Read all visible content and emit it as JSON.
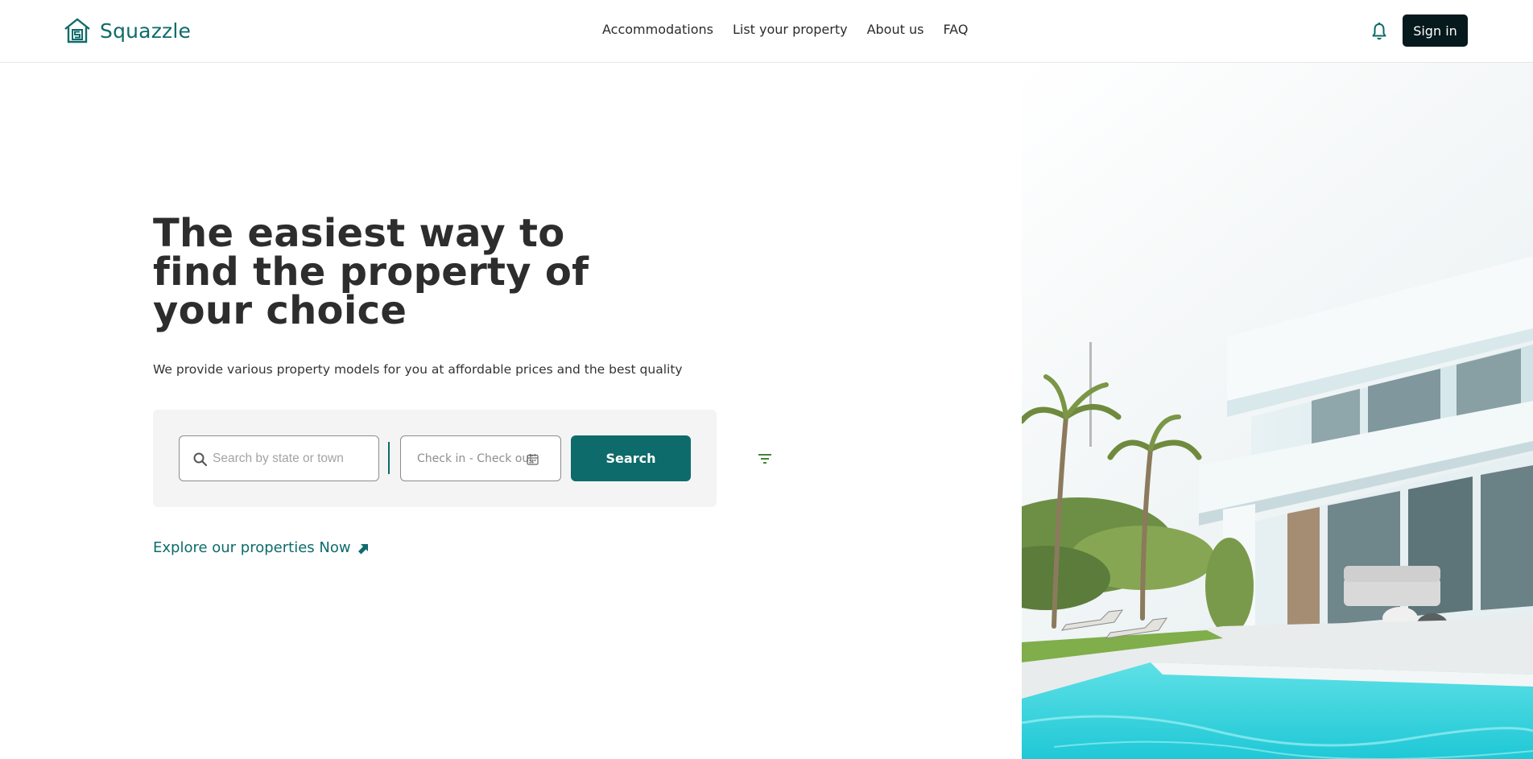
{
  "brand": {
    "name": "Squazzle",
    "color": "#0e6b6b"
  },
  "nav": {
    "links": [
      "Accommodations",
      "List your property",
      "About us",
      "FAQ"
    ]
  },
  "header": {
    "notification_icon": "bell-icon",
    "signin_label": "Sign in"
  },
  "hero": {
    "headline": "The easiest way to find the property of your choice",
    "subtext": "We provide various property models for you at affordable prices and the best quality",
    "search": {
      "location_placeholder": "Search by state or town",
      "dates_placeholder": "Check in - Check out",
      "button_label": "Search",
      "filter_icon": "filter-icon"
    },
    "explore_label": "Explore our properties Now",
    "image_alt": "Modern white villa with swimming pool and palm trees"
  },
  "colors": {
    "accent": "#0e6b6b",
    "signin_bg": "#06191d",
    "panel_bg": "#f4f4f4"
  }
}
